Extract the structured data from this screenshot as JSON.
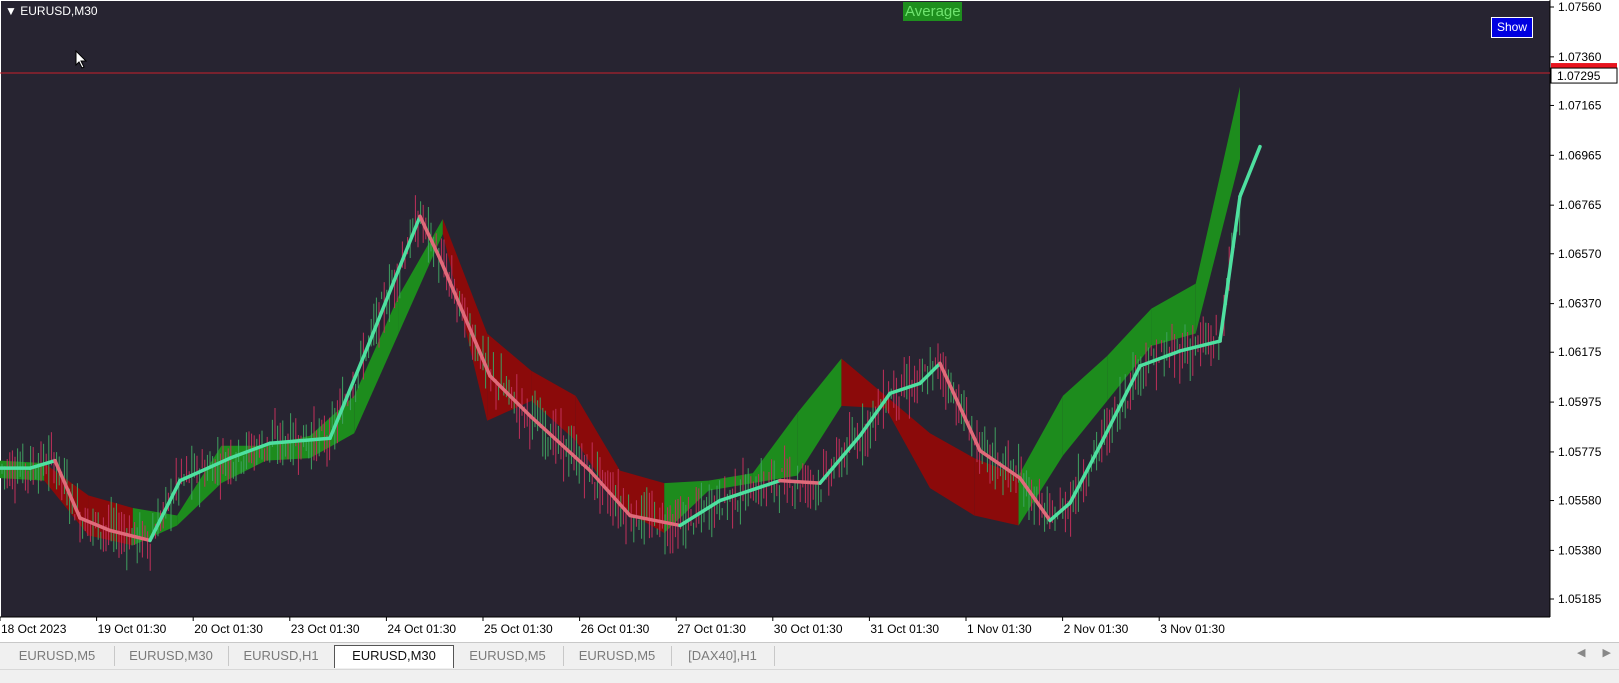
{
  "chart_title": "EURUSD,M30",
  "indicator_label": "Average",
  "show_button": "Show",
  "price_current": "1.07295",
  "y_axis": {
    "ticks": [
      "1.07560",
      "1.07360",
      "1.07165",
      "1.06965",
      "1.06765",
      "1.06570",
      "1.06370",
      "1.06175",
      "1.05975",
      "1.05775",
      "1.05580",
      "1.05380",
      "1.05185"
    ],
    "values": [
      1.0756,
      1.0736,
      1.07165,
      1.06965,
      1.06765,
      1.0657,
      1.0637,
      1.06175,
      1.05975,
      1.05775,
      1.0558,
      1.0538,
      1.05185
    ]
  },
  "x_axis": {
    "labels": [
      "18 Oct 2023",
      "19 Oct 01:30",
      "20 Oct 01:30",
      "23 Oct 01:30",
      "24 Oct 01:30",
      "25 Oct 01:30",
      "26 Oct 01:30",
      "27 Oct 01:30",
      "30 Oct 01:30",
      "31 Oct 01:30",
      "1 Nov 01:30",
      "2 Nov 01:30",
      "3 Nov 01:30"
    ]
  },
  "chart_data": {
    "type": "line",
    "x": [
      "18 Oct 2023",
      "19 Oct 01:30",
      "20 Oct 01:30",
      "23 Oct 01:30",
      "24 Oct 01:30",
      "25 Oct 01:30",
      "26 Oct 01:30",
      "27 Oct 01:30",
      "30 Oct 01:30",
      "31 Oct 01:30",
      "1 Nov 01:30",
      "2 Nov 01:30",
      "3 Nov 01:30"
    ],
    "ylim": [
      1.0512,
      1.0762
    ],
    "current_price": 1.07295,
    "series": [
      {
        "trend_line_points": [
          [
            0,
            1.0571
          ],
          [
            30,
            1.0571
          ],
          [
            55,
            1.0574
          ],
          [
            80,
            1.0551
          ],
          [
            110,
            1.0546
          ],
          [
            150,
            1.0542
          ],
          [
            180,
            1.0566
          ],
          [
            230,
            1.0575
          ],
          [
            270,
            1.0581
          ],
          [
            330,
            1.0583
          ],
          [
            370,
            1.0622
          ],
          [
            420,
            1.0672
          ],
          [
            440,
            1.0655
          ],
          [
            490,
            1.0608
          ],
          [
            530,
            1.0592
          ],
          [
            590,
            1.057
          ],
          [
            630,
            1.0552
          ],
          [
            680,
            1.0548
          ],
          [
            720,
            1.0558
          ],
          [
            780,
            1.0566
          ],
          [
            820,
            1.0565
          ],
          [
            860,
            1.0584
          ],
          [
            890,
            1.0601
          ],
          [
            920,
            1.0605
          ],
          [
            940,
            1.0613
          ],
          [
            980,
            1.0578
          ],
          [
            1020,
            1.0567
          ],
          [
            1050,
            1.055
          ],
          [
            1070,
            1.0557
          ],
          [
            1100,
            1.058
          ],
          [
            1140,
            1.0612
          ],
          [
            1180,
            1.0618
          ],
          [
            1220,
            1.0622
          ],
          [
            1240,
            1.068
          ],
          [
            1260,
            1.07
          ]
        ],
        "cloud_top": [
          1.0574,
          1.0573,
          1.056,
          1.0555,
          1.0552,
          1.058,
          1.058,
          1.0584,
          1.06,
          1.064,
          1.0671,
          1.0625,
          1.061,
          1.06,
          1.057,
          1.0565,
          1.0566,
          1.0569,
          1.0593,
          1.0615,
          1.06,
          1.0585,
          1.0575,
          1.0568,
          1.06,
          1.0616,
          1.0635,
          1.0645,
          1.0724
        ],
        "cloud_bottom": [
          1.0567,
          1.0566,
          1.0544,
          1.054,
          1.0548,
          1.0565,
          1.0574,
          1.0575,
          1.0585,
          1.0625,
          1.0665,
          1.059,
          1.0598,
          1.0582,
          1.0555,
          1.0545,
          1.0562,
          1.0565,
          1.0568,
          1.0596,
          1.0595,
          1.0563,
          1.0552,
          1.0548,
          1.0576,
          1.0598,
          1.062,
          1.0625,
          1.0695
        ]
      }
    ]
  },
  "tabs": [
    "EURUSD,M5",
    "EURUSD,M30",
    "EURUSD,H1",
    "EURUSD,M30",
    "EURUSD,M5",
    "EURUSD,M5",
    "[DAX40],H1"
  ],
  "active_tab_index": 3,
  "colors": {
    "background": "#272431",
    "bull": "#1d8c1d",
    "bear": "#8b0a0a",
    "trend_up": "#4ee0a0",
    "trend_down": "#e06a7a",
    "current_line": "#c8202a"
  }
}
